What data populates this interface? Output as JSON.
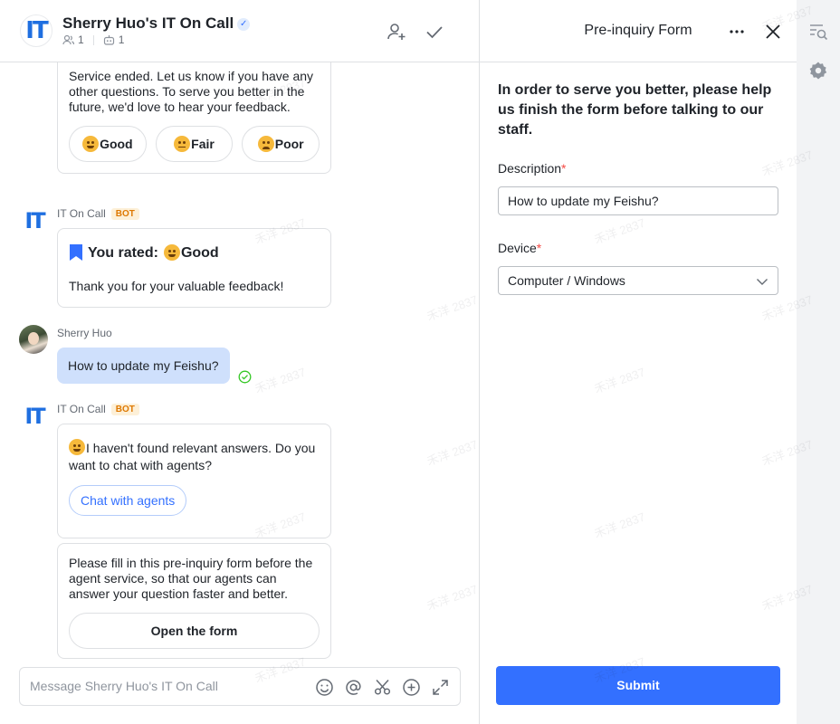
{
  "chat": {
    "logo_text": "IT",
    "title": "Sherry Huo's IT On Call",
    "members_count": "1",
    "bots_count": "1",
    "messages": {
      "feedback_card_text": "Service ended. Let us know if you have any other questions. To serve you better in the future, we'd love to hear your feedback.",
      "rating_good": "Good",
      "rating_fair": "Fair",
      "rating_poor": "Poor",
      "bot_name": "IT On Call",
      "bot_tag": "BOT",
      "rated_label": "You rated:",
      "rated_value": "Good",
      "rated_thanks": "Thank you for your valuable feedback!",
      "user_name": "Sherry Huo",
      "user_message": "How to update my Feishu?",
      "not_found_text": "I haven't found relevant answers. Do you want to chat with agents?",
      "chat_agents_button": "Chat with agents",
      "form_prompt_text": "Please fill in this pre-inquiry form before the agent service, so that our agents can answer your question faster and better.",
      "open_form_button": "Open the form"
    },
    "composer_placeholder": "Message Sherry Huo's IT On Call"
  },
  "form": {
    "title": "Pre-inquiry Form",
    "intro": "In order to serve you better, please help us finish the form before talking to our staff.",
    "description_label": "Description",
    "required_mark": "*",
    "description_value": "How to update my Feishu?",
    "device_label": "Device",
    "device_value": "Computer / Windows",
    "submit_label": "Submit"
  },
  "watermark": "禾洋 2837",
  "colors": {
    "accent": "#3370ff",
    "logo": "#1f6fe0",
    "bot_tag": "#de7802",
    "required": "#f54a45",
    "user_bubble": "#cfe0fc"
  }
}
